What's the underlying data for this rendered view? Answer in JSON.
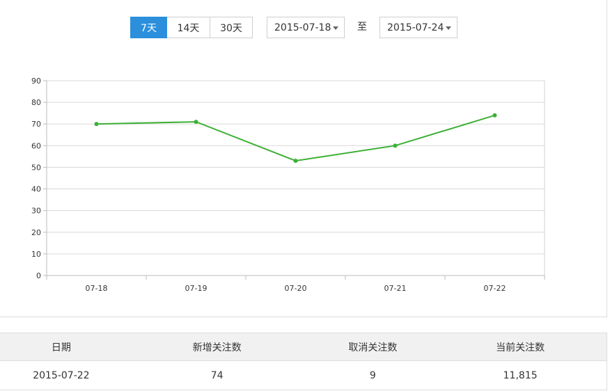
{
  "controls": {
    "range_buttons": [
      {
        "label": "7天",
        "active": true
      },
      {
        "label": "14天",
        "active": false
      },
      {
        "label": "30天",
        "active": false
      }
    ],
    "start_date": "2015-07-18",
    "separator": "至",
    "end_date": "2015-07-24"
  },
  "chart_data": {
    "type": "line",
    "categories": [
      "07-18",
      "07-19",
      "07-20",
      "07-21",
      "07-22"
    ],
    "series": [
      {
        "values": [
          70,
          71,
          53,
          60,
          74
        ],
        "color": "#3cb034"
      }
    ],
    "ylim": [
      0,
      90
    ],
    "yticks": [
      0,
      10,
      20,
      30,
      40,
      50,
      60,
      70,
      80,
      90
    ],
    "grid": true,
    "title": "",
    "xlabel": "",
    "ylabel": ""
  },
  "table": {
    "headers": [
      "日期",
      "新增关注数",
      "取消关注数",
      "当前关注数"
    ],
    "rows": [
      [
        "2015-07-22",
        "74",
        "9",
        "11,815"
      ]
    ]
  }
}
